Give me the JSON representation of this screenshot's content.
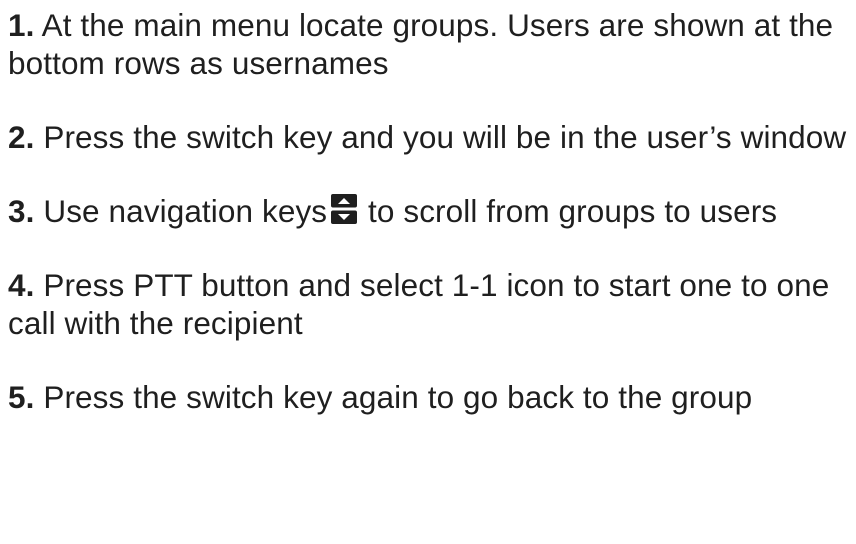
{
  "steps": [
    {
      "number": "1.",
      "text": "At the main menu locate groups. Users are shown at the bottom rows as usernames"
    },
    {
      "number": "2.",
      "text": "Press the switch key and you will be in the user’s window"
    },
    {
      "number": "3.",
      "text_before": "Use navigation keys",
      "icon": "up-down-navigation-icon",
      "text_after": "to scroll from groups to users"
    },
    {
      "number": "4.",
      "text": "Press PTT button and select 1-1 icon to start one to one call with the recipient"
    },
    {
      "number": "5.",
      "text": "Press the switch key again to go back to the group"
    }
  ]
}
